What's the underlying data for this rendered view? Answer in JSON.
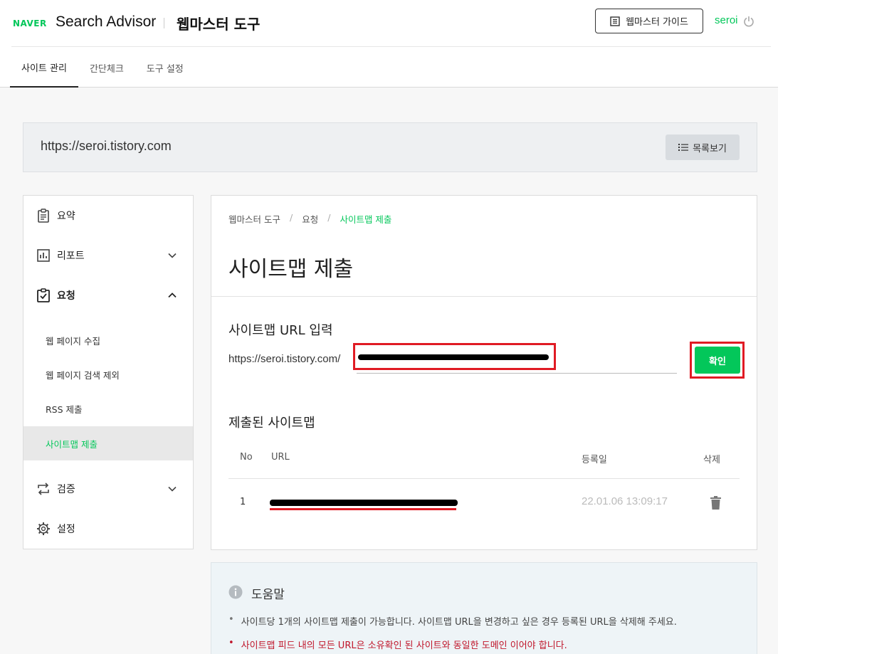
{
  "header": {
    "brand": "NAVER",
    "app_name": "Search Advisor",
    "tool_title": "웹마스터 도구",
    "guide_button": "웹마스터 가이드",
    "user": "seroi"
  },
  "tabs": [
    {
      "label": "사이트 관리",
      "active": true
    },
    {
      "label": "간단체크",
      "active": false
    },
    {
      "label": "도구 설정",
      "active": false
    }
  ],
  "site_bar": {
    "url": "https://seroi.tistory.com",
    "list_button": "목록보기"
  },
  "sidebar": {
    "summary": "요약",
    "report": "리포트",
    "request": "요청",
    "sub_items": [
      "웹 페이지 수집",
      "웹 페이지 검색 제외",
      "RSS 제출",
      "사이트맵 제출"
    ],
    "verify": "검증",
    "settings": "설정"
  },
  "main": {
    "breadcrumb": [
      "웹마스터 도구",
      "요청",
      "사이트맵 제출"
    ],
    "breadcrumb_sep": "/",
    "title": "사이트맵 제출",
    "input_section_title": "사이트맵 URL 입력",
    "url_prefix": "https://seroi.tistory.com/",
    "confirm_button": "확인",
    "submitted_title": "제출된 사이트맵",
    "table": {
      "headers": {
        "no": "No",
        "url": "URL",
        "date": "등록일",
        "delete": "삭제"
      },
      "rows": [
        {
          "no": "1",
          "date": "22.01.06 13:09:17"
        }
      ]
    }
  },
  "help": {
    "title": "도움말",
    "items": [
      "사이트당 1개의 사이트맵 제출이 가능합니다. 사이트맵 URL을 변경하고 싶은 경우 등록된 URL을 삭제해 주세요.",
      "사이트맵 피드 내의 모든 URL은 소유확인 된 사이트와 동일한 도메인 이어야 합니다."
    ],
    "bullet": "•"
  },
  "colors": {
    "brand_green": "#03c75a",
    "highlight_red": "#e01b24",
    "warning_text": "#c0162b"
  }
}
